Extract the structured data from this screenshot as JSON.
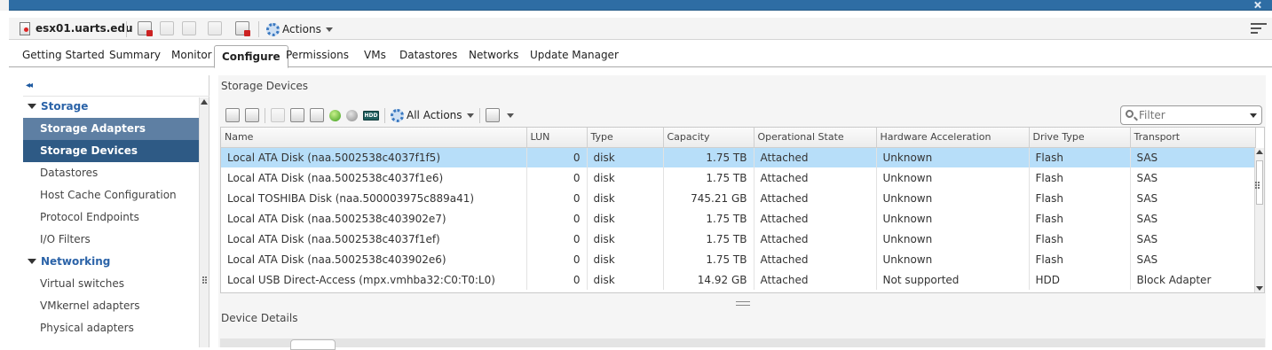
{
  "host": {
    "name": "esx01.uarts.edu",
    "icon": "host-warning-icon"
  },
  "toolbar": {
    "actions_label": "Actions"
  },
  "tabs": [
    {
      "label": "Getting Started"
    },
    {
      "label": "Summary"
    },
    {
      "label": "Monitor"
    },
    {
      "label": "Configure",
      "active": true
    },
    {
      "label": "Permissions"
    },
    {
      "label": "VMs"
    },
    {
      "label": "Datastores"
    },
    {
      "label": "Networks"
    },
    {
      "label": "Update Manager"
    }
  ],
  "nav": {
    "collapse_glyph": "◂◂",
    "storage": {
      "heading": "Storage",
      "items": [
        "Storage Adapters",
        "Storage Devices",
        "Datastores",
        "Host Cache Configuration",
        "Protocol Endpoints",
        "I/O Filters"
      ]
    },
    "networking": {
      "heading": "Networking",
      "items": [
        "Virtual switches",
        "VMkernel adapters",
        "Physical adapters"
      ]
    }
  },
  "panel": {
    "title": "Storage Devices",
    "all_actions_label": "All Actions",
    "filter_placeholder": "Filter",
    "hdd_icon_text": "HDD"
  },
  "table": {
    "columns": [
      "Name",
      "LUN",
      "Type",
      "Capacity",
      "Operational State",
      "Hardware Acceleration",
      "Drive Type",
      "Transport"
    ],
    "rows": [
      {
        "name": "Local ATA Disk (naa.5002538c4037f1f5)",
        "lun": "0",
        "type": "disk",
        "capacity": "1.75 TB",
        "state": "Attached",
        "hwaccel": "Unknown",
        "drive": "Flash",
        "transport": "SAS",
        "selected": true
      },
      {
        "name": "Local ATA Disk (naa.5002538c4037f1e6)",
        "lun": "0",
        "type": "disk",
        "capacity": "1.75 TB",
        "state": "Attached",
        "hwaccel": "Unknown",
        "drive": "Flash",
        "transport": "SAS"
      },
      {
        "name": "Local TOSHIBA Disk (naa.500003975c889a41)",
        "lun": "0",
        "type": "disk",
        "capacity": "745.21 GB",
        "state": "Attached",
        "hwaccel": "Unknown",
        "drive": "Flash",
        "transport": "SAS"
      },
      {
        "name": "Local ATA Disk (naa.5002538c403902e7)",
        "lun": "0",
        "type": "disk",
        "capacity": "1.75 TB",
        "state": "Attached",
        "hwaccel": "Unknown",
        "drive": "Flash",
        "transport": "SAS"
      },
      {
        "name": "Local ATA Disk (naa.5002538c4037f1ef)",
        "lun": "0",
        "type": "disk",
        "capacity": "1.75 TB",
        "state": "Attached",
        "hwaccel": "Unknown",
        "drive": "Flash",
        "transport": "SAS"
      },
      {
        "name": "Local ATA Disk (naa.5002538c403902e6)",
        "lun": "0",
        "type": "disk",
        "capacity": "1.75 TB",
        "state": "Attached",
        "hwaccel": "Unknown",
        "drive": "Flash",
        "transport": "SAS"
      },
      {
        "name": "Local USB Direct-Access (mpx.vmhba32:C0:T0:L0)",
        "lun": "0",
        "type": "disk",
        "capacity": "14.92 GB",
        "state": "Attached",
        "hwaccel": "Not supported",
        "drive": "HDD",
        "transport": "Block Adapter"
      }
    ]
  },
  "details": {
    "title": "Device Details"
  },
  "colors": {
    "accent": "#2e6da4",
    "nav_selected": "#2e5a85",
    "nav_hover": "#5e7fa3",
    "row_selected": "#b7def9"
  }
}
